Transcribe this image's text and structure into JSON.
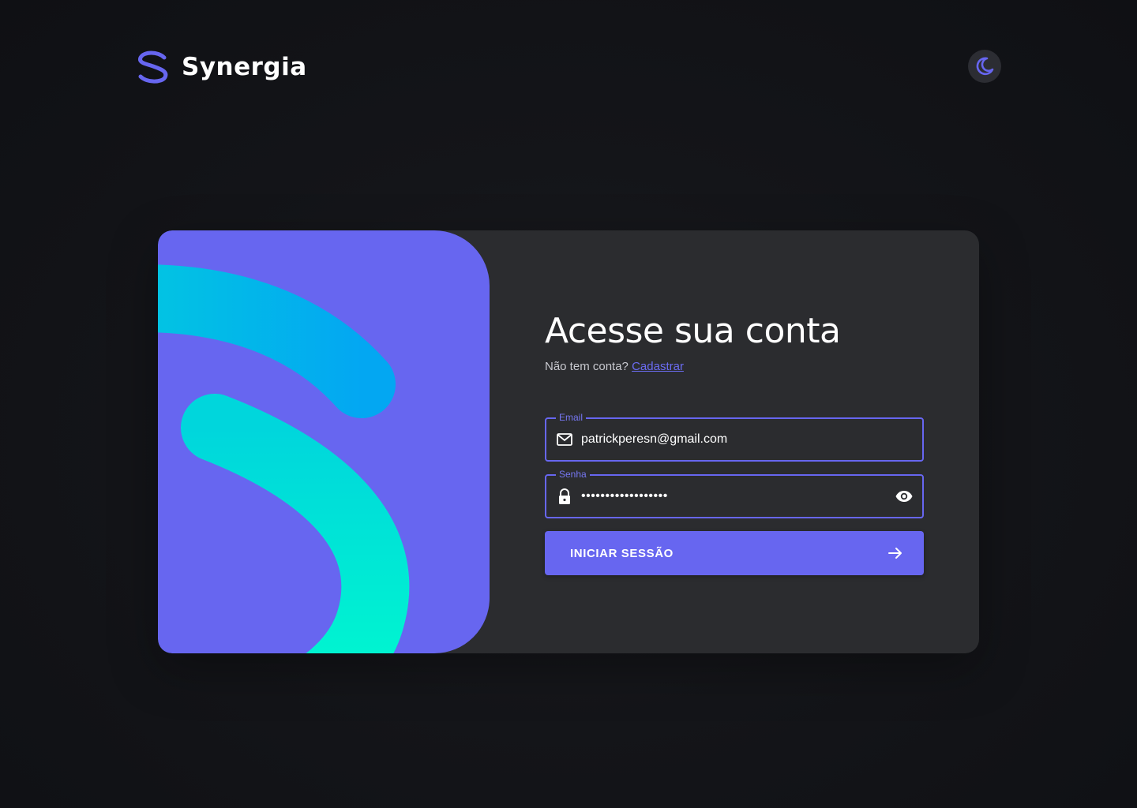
{
  "brand": {
    "name": "Synergia",
    "logo_icon": "synergia-s-logo",
    "accent_color": "#6766f0"
  },
  "header": {
    "theme_toggle_icon": "moon-icon"
  },
  "login": {
    "title": "Acesse sua conta",
    "signup_prompt": "Não tem conta?",
    "signup_link": "Cadastrar",
    "email": {
      "label": "Email",
      "value": "patrickperesn@gmail.com",
      "icon": "mail-icon"
    },
    "password": {
      "label": "Senha",
      "value": "••••••••••••••••••",
      "icon": "lock-icon",
      "toggle_icon": "eye-icon"
    },
    "submit": {
      "label": "INICIAR SESSÃO",
      "icon": "arrow-right-icon"
    }
  },
  "colors": {
    "page_background": "#131418",
    "card_background": "#2b2c2f",
    "art_background": "#6766f0",
    "art_arc_top": "#00aaf0",
    "art_arc_bottom": "#00f5cf"
  }
}
